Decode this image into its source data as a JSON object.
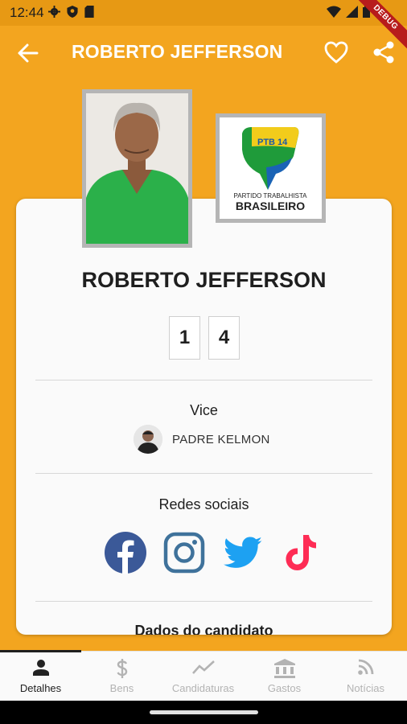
{
  "status_bar": {
    "time": "12:44",
    "debug_label": "DEBUG"
  },
  "app_bar": {
    "title": "ROBERTO JEFFERSON"
  },
  "party_logo": {
    "badge": "PTB 14",
    "line1": "PARTIDO TRABALHISTA",
    "line2": "BRASILEIRO"
  },
  "candidate": {
    "name": "ROBERTO JEFFERSON",
    "number_digits": [
      "1",
      "4"
    ]
  },
  "vice": {
    "section_title": "Vice",
    "name": "PADRE KELMON"
  },
  "social": {
    "section_title": "Redes sociais",
    "networks": [
      "facebook-icon",
      "instagram-icon",
      "twitter-icon",
      "tiktok-icon"
    ]
  },
  "dados": {
    "section_title": "Dados do candidato"
  },
  "bottom_nav": {
    "items": [
      {
        "label": "Detalhes",
        "icon": "person-icon"
      },
      {
        "label": "Bens",
        "icon": "dollar-icon"
      },
      {
        "label": "Candidaturas",
        "icon": "trend-icon"
      },
      {
        "label": "Gastos",
        "icon": "bank-icon"
      },
      {
        "label": "Notícias",
        "icon": "rss-icon"
      }
    ],
    "active_index": 0
  },
  "colors": {
    "primary": "#f3a51f",
    "status_bar": "#e79914",
    "facebook": "#3b5998",
    "instagram": "#3f729b",
    "twitter": "#1da1f2",
    "tiktok": "#fe2c55"
  }
}
